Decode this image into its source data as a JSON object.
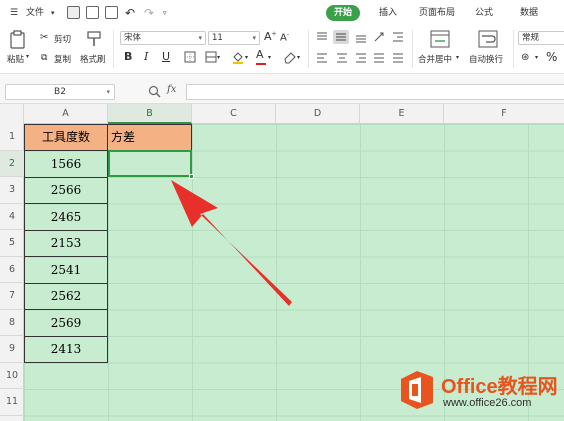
{
  "menubar": {
    "file_label": "文件",
    "tabs": [
      "开始",
      "插入",
      "页面布局",
      "公式",
      "数据"
    ]
  },
  "ribbon": {
    "paste_label": "粘贴",
    "cut_label": "剪切",
    "copy_label": "复制",
    "format_painter_label": "格式刷",
    "font_name": "宋体",
    "font_size": "11",
    "grow_font": "A",
    "shrink_font": "A",
    "bold": "B",
    "italic": "I",
    "underline": "U",
    "font_color_letter": "A",
    "merge_label": "合并居中",
    "wrap_label": "自动换行",
    "number_format": "常规",
    "percent": "%"
  },
  "formula_bar": {
    "name_box": "B2",
    "fx_label": "fx",
    "formula": ""
  },
  "sheet": {
    "columns": [
      "A",
      "B",
      "C",
      "D",
      "E",
      "F"
    ],
    "rows": [
      "1",
      "2",
      "3",
      "4",
      "5",
      "6",
      "7",
      "8",
      "9",
      "10",
      "11"
    ],
    "a1": "工具度数",
    "b1": "方差",
    "values": [
      "1566",
      "2566",
      "2465",
      "2153",
      "2541",
      "2562",
      "2569",
      "2413"
    ],
    "selected_cell": "B2"
  },
  "colors": {
    "accent": "#3aa14a",
    "sheet_background": "#c8ecd0",
    "header_fill": "#f4b183",
    "arrow": "#e8302a",
    "watermark": "#e8541e"
  },
  "watermark": {
    "title": "Office教程网",
    "url": "www.office26.com"
  }
}
